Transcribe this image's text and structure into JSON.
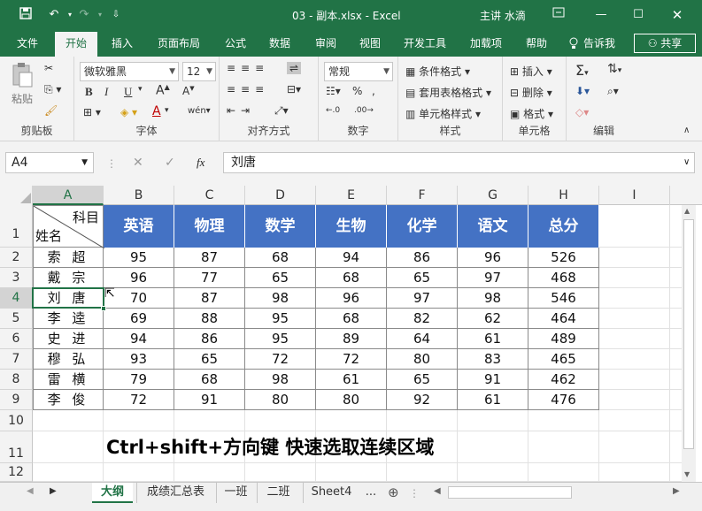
{
  "titlebar": {
    "file_title": "03 - 副本.xlsx - Excel",
    "user": "主讲 水滴",
    "save_icon": "save-icon",
    "undo_icon": "undo-icon",
    "redo_icon": "redo-icon"
  },
  "ribbon_tabs": [
    "文件",
    "开始",
    "插入",
    "页面布局",
    "公式",
    "数据",
    "审阅",
    "视图",
    "开发工具",
    "加载项",
    "帮助",
    "告诉我",
    "共享"
  ],
  "ribbon": {
    "clipboard": {
      "paste": "粘贴",
      "label": "剪贴板"
    },
    "font": {
      "name": "微软雅黑",
      "size": "12",
      "label": "字体",
      "bold": "B",
      "italic": "I",
      "underline": "U"
    },
    "alignment": {
      "label": "对齐方式"
    },
    "number": {
      "format": "常规",
      "label": "数字"
    },
    "styles": {
      "conditional": "条件格式",
      "table": "套用表格格式",
      "cell": "单元格样式",
      "label": "样式"
    },
    "cells": {
      "insert": "插入",
      "delete": "删除",
      "format": "格式",
      "label": "单元格"
    },
    "editing": {
      "label": "编辑"
    }
  },
  "formula_bar": {
    "name_box": "A4",
    "fx": "fx",
    "value": "刘唐"
  },
  "columns": [
    "A",
    "B",
    "C",
    "D",
    "E",
    "F",
    "G",
    "H",
    "I"
  ],
  "rows": [
    "1",
    "2",
    "3",
    "4",
    "5",
    "6",
    "7",
    "8",
    "9",
    "10",
    "11",
    "12"
  ],
  "table": {
    "corner_top": "科目",
    "corner_bottom": "姓名",
    "headers": [
      "英语",
      "物理",
      "数学",
      "生物",
      "化学",
      "语文",
      "总分"
    ],
    "records": [
      {
        "name": "索 超",
        "values": [
          "95",
          "87",
          "68",
          "94",
          "86",
          "96",
          "526"
        ]
      },
      {
        "name": "戴 宗",
        "values": [
          "96",
          "77",
          "65",
          "68",
          "65",
          "97",
          "468"
        ]
      },
      {
        "name": "刘 唐",
        "values": [
          "70",
          "87",
          "98",
          "96",
          "97",
          "98",
          "546"
        ]
      },
      {
        "name": "李 逵",
        "values": [
          "69",
          "88",
          "95",
          "68",
          "82",
          "62",
          "464"
        ]
      },
      {
        "name": "史 进",
        "values": [
          "94",
          "86",
          "95",
          "89",
          "64",
          "61",
          "489"
        ]
      },
      {
        "name": "穆 弘",
        "values": [
          "93",
          "65",
          "72",
          "72",
          "80",
          "83",
          "465"
        ]
      },
      {
        "name": "雷 横",
        "values": [
          "79",
          "68",
          "98",
          "61",
          "65",
          "91",
          "462"
        ]
      },
      {
        "name": "李 俊",
        "values": [
          "72",
          "91",
          "80",
          "80",
          "92",
          "61",
          "476"
        ]
      }
    ]
  },
  "caption": "Ctrl+shift+方向键 快速选取连续区域",
  "sheet_tabs": [
    "大纲",
    "成绩汇总表",
    "一班",
    "二班",
    "Sheet4",
    "..."
  ],
  "active_sheet": "大纲",
  "colors": {
    "excel_green": "#217346",
    "header_blue": "#4472c4"
  }
}
